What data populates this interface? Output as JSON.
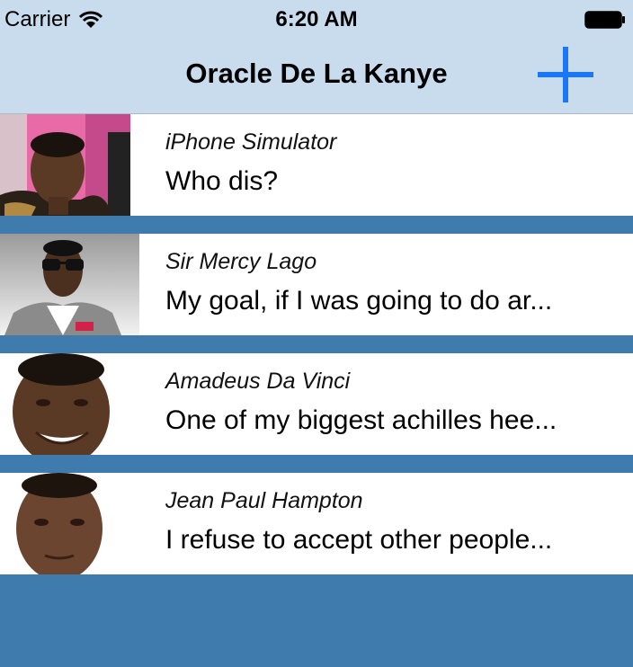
{
  "status_bar": {
    "carrier": "Carrier",
    "time": "6:20 AM",
    "icons": [
      "wifi-icon",
      "battery-icon"
    ]
  },
  "nav": {
    "title": "Oracle De La Kanye",
    "add_icon": "plus-icon"
  },
  "colors": {
    "nav_background": "#c8dcee",
    "list_background": "#3f7bad",
    "accent": "#1a78f4",
    "row_background": "#ffffff"
  },
  "messages": [
    {
      "author": "iPhone Simulator",
      "text": "Who dis?",
      "avatar": "kanye-photo-1"
    },
    {
      "author": "Sir Mercy Lago",
      "text": "My goal, if I was going to do ar...",
      "avatar": "kanye-photo-2"
    },
    {
      "author": "Amadeus Da Vinci",
      "text": "One of my biggest achilles hee...",
      "avatar": "kanye-photo-3"
    },
    {
      "author": "Jean Paul Hampton",
      "text": "I refuse to accept other people...",
      "avatar": "kanye-photo-4"
    }
  ]
}
